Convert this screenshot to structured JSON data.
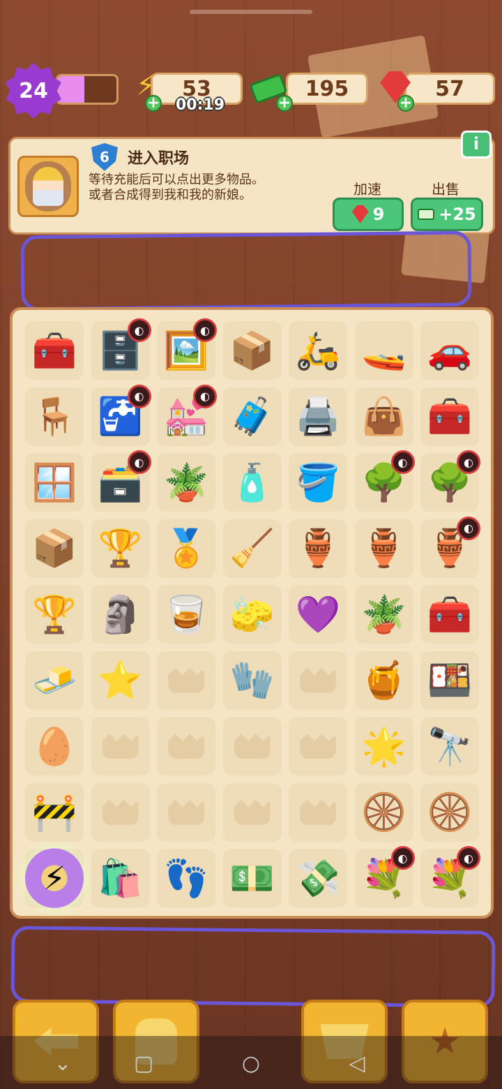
{
  "status": {
    "level": "24",
    "level_progress": 0.45,
    "energy": "53",
    "energy_timer": "00:19",
    "cash": "195",
    "gems": "57",
    "energy_icon": "lightning-icon",
    "cash_icon": "cash-stack-icon",
    "gem_icon": "ruby-icon"
  },
  "task": {
    "badge_number": "6",
    "title": "进入职场",
    "line1": "等待充能后可以点出更多物品。",
    "line2": "或者合成得到我和我的新娘。",
    "info_label": "i",
    "speedup_label": "加速",
    "speedup_cost": "9",
    "sell_label": "出售",
    "sell_value": "+25"
  },
  "board": {
    "rows": [
      [
        "medical-kit",
        "wardrobe-locked",
        "portrait-frame-locked",
        "wooden-crates",
        "scooter",
        "jet-ski",
        "purple-car"
      ],
      [
        "wrecked-desk",
        "sink-locked",
        "wedding-photo-locked",
        "red-toolbox-damaged",
        "red-machine-damaged",
        "red-bag-damaged",
        "red-chest-damaged"
      ],
      [
        "broken-glass-box",
        "green-cabinet-locked",
        "potted-plant",
        "green-bottle",
        "yellow-bucket",
        "flowering-bush-locked",
        "flowering-bush-locked"
      ],
      [
        "dusty-crate",
        "gold-star-trophy",
        "silver-star-trophy",
        "green-broom",
        "clay-pot",
        "broken-pot",
        "vase-locked"
      ],
      [
        "gold-winged-trophy",
        "gold-figurine",
        "glass-trophy",
        "green-sponge",
        "purple-gem",
        "clay-pot-small",
        "red-toolbox"
      ],
      [
        "yellow-cushion",
        "glass-star",
        "empty",
        "green-cloth",
        "empty",
        "broken-pot-small",
        "red-lunchbox"
      ],
      [
        "yellow-pill",
        "empty",
        "empty",
        "empty",
        "empty",
        "purple-star",
        "binoculars"
      ],
      [
        "road-barrier",
        "empty",
        "empty",
        "empty",
        "empty",
        "wheel-pair",
        "wheel"
      ],
      [
        "energy-orb",
        "clue-bag",
        "footprint-bag",
        "cash-pile",
        "cash-bundle",
        "flower-bouquet-locked",
        "flower-bouquet-locked"
      ]
    ]
  },
  "bottom": {
    "back_icon": "back-arrow-icon",
    "backpack_icon": "backpack-icon",
    "shop_icon": "basket-icon",
    "album_icon": "star-album-icon"
  },
  "navbar": {
    "down_icon": "chevron-down-icon",
    "recent_icon": "square-icon",
    "home_icon": "circle-icon",
    "back_icon": "triangle-back-icon"
  }
}
